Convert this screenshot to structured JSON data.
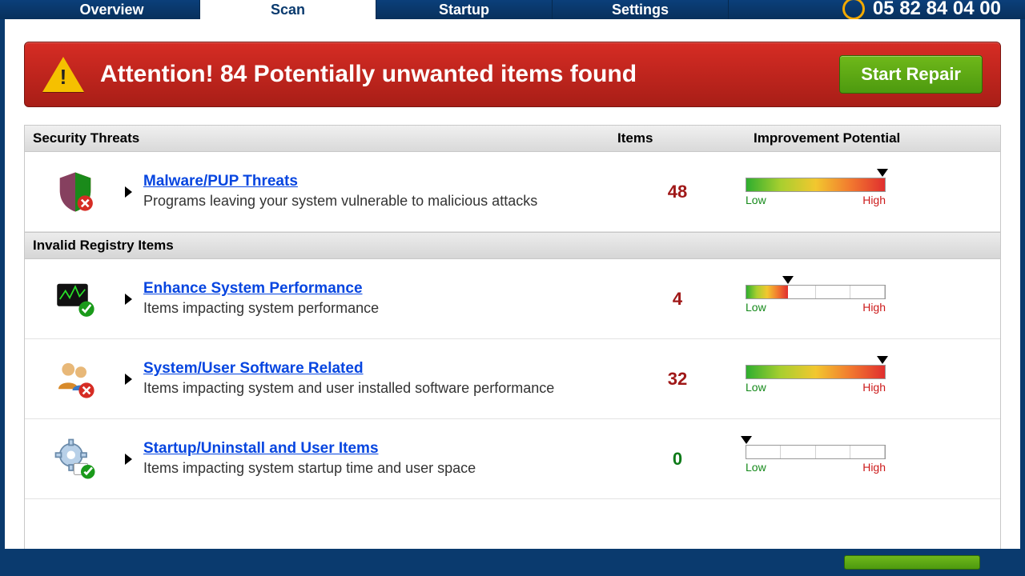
{
  "tabs": {
    "overview": "Overview",
    "scan": "Scan",
    "startup": "Startup",
    "settings": "Settings",
    "active": "scan"
  },
  "phone_number": "05 82 84 04 00",
  "alert": {
    "text": "Attention! 84 Potentially unwanted items found",
    "button": "Start Repair"
  },
  "columns": {
    "title": "Security Threats",
    "items": "Items",
    "potential": "Improvement Potential"
  },
  "meter_labels": {
    "low": "Low",
    "high": "High"
  },
  "sections": [
    {
      "heading_is_column": true,
      "heading": "Security Threats",
      "rows": [
        {
          "icon": "shield",
          "title": "Malware/PUP Threats",
          "subtitle": "Programs leaving your system vulnerable to malicious attacks",
          "count": 48,
          "fill_pct": 100,
          "marker_pct": 98
        }
      ]
    },
    {
      "heading": "Invalid Registry Items",
      "rows": [
        {
          "icon": "monitor",
          "title": "Enhance System Performance",
          "subtitle": "Items impacting system performance",
          "count": 4,
          "fill_pct": 30,
          "marker_pct": 30
        },
        {
          "icon": "users",
          "title": "System/User Software Related",
          "subtitle": "Items impacting system and user installed software performance",
          "count": 32,
          "fill_pct": 100,
          "marker_pct": 98
        },
        {
          "icon": "gear",
          "title": "Startup/Uninstall and User Items",
          "subtitle": "Items impacting system startup time and user space",
          "count": 0,
          "fill_pct": 0,
          "marker_pct": 0
        }
      ]
    }
  ]
}
